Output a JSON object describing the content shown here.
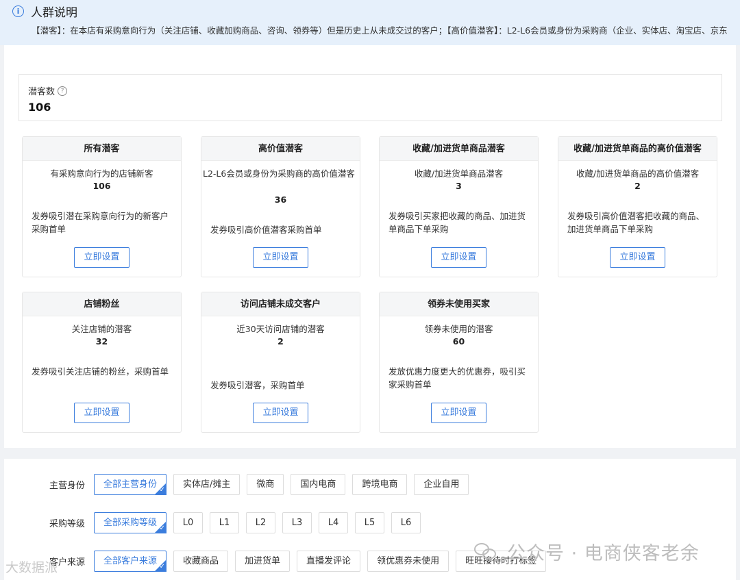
{
  "info": {
    "title": "人群说明",
    "description": "【潜客】：在本店有采购意向行为（关注店铺、收藏加购商品、咨询、领券等）但是历史上从未成交过的客户；【高价值潜客】：L2-L6会员或身份为采购商（企业、实体店、淘宝店、京东"
  },
  "stat": {
    "label": "潜客数",
    "value": "106"
  },
  "cards": [
    {
      "title": "所有潜客",
      "desc": "有采购意向行为的店铺新客",
      "count": "106",
      "note": "发券吸引潜在采购意向行为的新客户采购首单",
      "button": "立即设置"
    },
    {
      "title": "高价值潜客",
      "desc": "L2-L6会员或身份为采购商的高价值潜客",
      "count": "36",
      "note": "发券吸引高价值潜客采购首单",
      "button": "立即设置"
    },
    {
      "title": "收藏/加进货单商品潜客",
      "desc": "收藏/加进货单商品潜客",
      "count": "3",
      "note": "发券吸引买家把收藏的商品、加进货单商品下单采购",
      "button": "立即设置"
    },
    {
      "title": "收藏/加进货单商品的高价值潜客",
      "desc": "收藏/加进货单商品的高价值潜客",
      "count": "2",
      "note": "发券吸引高价值潜客把收藏的商品、加进货单商品下单采购",
      "button": "立即设置"
    },
    {
      "title": "店铺粉丝",
      "desc": "关注店铺的潜客",
      "count": "32",
      "note": "发券吸引关注店铺的粉丝，采购首单",
      "button": "立即设置"
    },
    {
      "title": "访问店铺未成交客户",
      "desc": "近30天访问店铺的潜客",
      "count": "2",
      "note": "发券吸引潜客，采购首单",
      "button": "立即设置"
    },
    {
      "title": "领券未使用买家",
      "desc": "领券未使用的潜客",
      "count": "60",
      "note": "发放优惠力度更大的优惠券，吸引买家采购首单",
      "button": "立即设置"
    }
  ],
  "filters": {
    "identity": {
      "label": "主营身份",
      "options": [
        "全部主营身份",
        "实体店/摊主",
        "微商",
        "国内电商",
        "跨境电商",
        "企业自用"
      ]
    },
    "level": {
      "label": "采购等级",
      "options": [
        "全部采购等级",
        "L0",
        "L1",
        "L2",
        "L3",
        "L4",
        "L5",
        "L6"
      ]
    },
    "source": {
      "label": "客户来源",
      "options": [
        "全部客户来源",
        "收藏商品",
        "加进货单",
        "直播发评论",
        "领优惠券未使用",
        "旺旺接待时打标签"
      ]
    }
  },
  "watermark": {
    "text": "公众号 · 电商侠客老余",
    "text2": "大数据派"
  },
  "colors": {
    "accent": "#3b7ddd",
    "info_bg": "#e6f0fb"
  }
}
